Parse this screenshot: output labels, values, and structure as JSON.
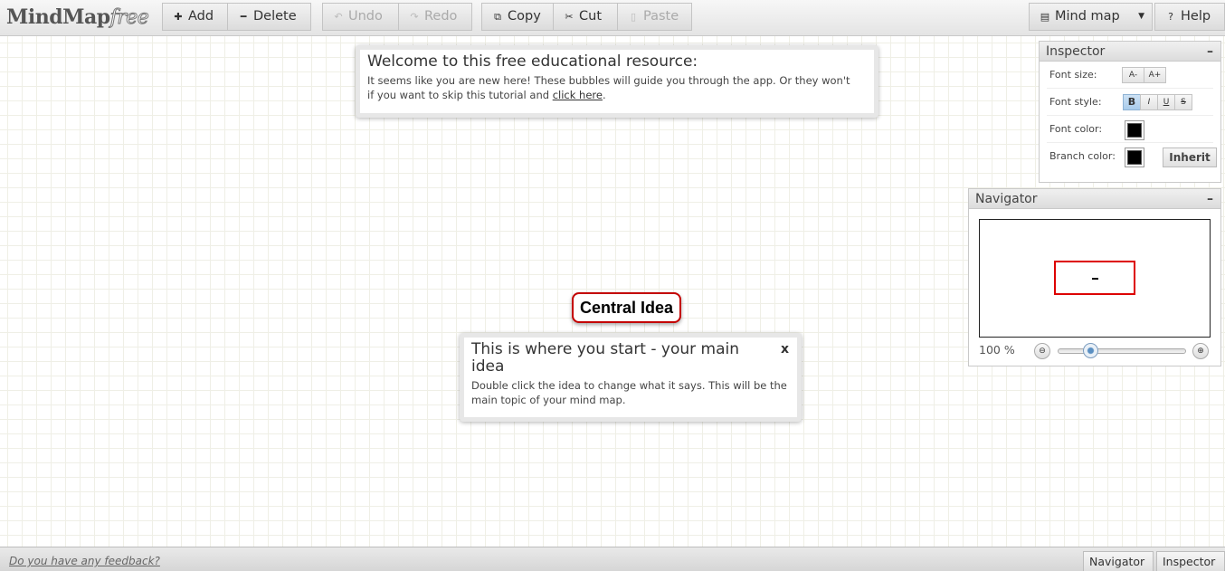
{
  "app": {
    "logo_main": "MindMap",
    "logo_suffix": "free"
  },
  "toolbar": {
    "add": "Add",
    "delete": "Delete",
    "undo": "Undo",
    "redo": "Redo",
    "copy": "Copy",
    "cut": "Cut",
    "paste": "Paste",
    "mindmap_menu": "Mind map",
    "help": "Help"
  },
  "welcome_bubble": {
    "title": "Welcome to this free educational resource:",
    "text_line1": "It seems like you are new here! These bubbles will guide you through the app. Or they won't",
    "text_line2_pre": "if you want to skip this tutorial and ",
    "link": "click here",
    "text_line2_post": "."
  },
  "central_node": {
    "label": "Central Idea"
  },
  "start_bubble": {
    "title": "This is where you start - your main idea",
    "text": "Double click the idea to change what it says. This will be the main topic of your mind map.",
    "close": "x"
  },
  "inspector": {
    "title": "Inspector",
    "minimize": "–",
    "font_size_label": "Font size:",
    "font_size_decrease": "A-",
    "font_size_increase": "A+",
    "font_style_label": "Font style:",
    "bold": "B",
    "italic": "I",
    "underline": "U",
    "strike": "S",
    "font_color_label": "Font color:",
    "branch_color_label": "Branch color:",
    "inherit": "Inherit",
    "font_color": "#000000",
    "branch_color": "#000000"
  },
  "navigator": {
    "title": "Navigator",
    "minimize": "–",
    "zoom_label": "100 %",
    "zoom_level": 0.25
  },
  "statusbar": {
    "feedback": "Do you have any feedback?",
    "navigator_btn": "Navigator",
    "inspector_btn": "Inspector"
  },
  "colors": {
    "central_border": "#c40000",
    "viewport_rect": "#dd0000"
  }
}
